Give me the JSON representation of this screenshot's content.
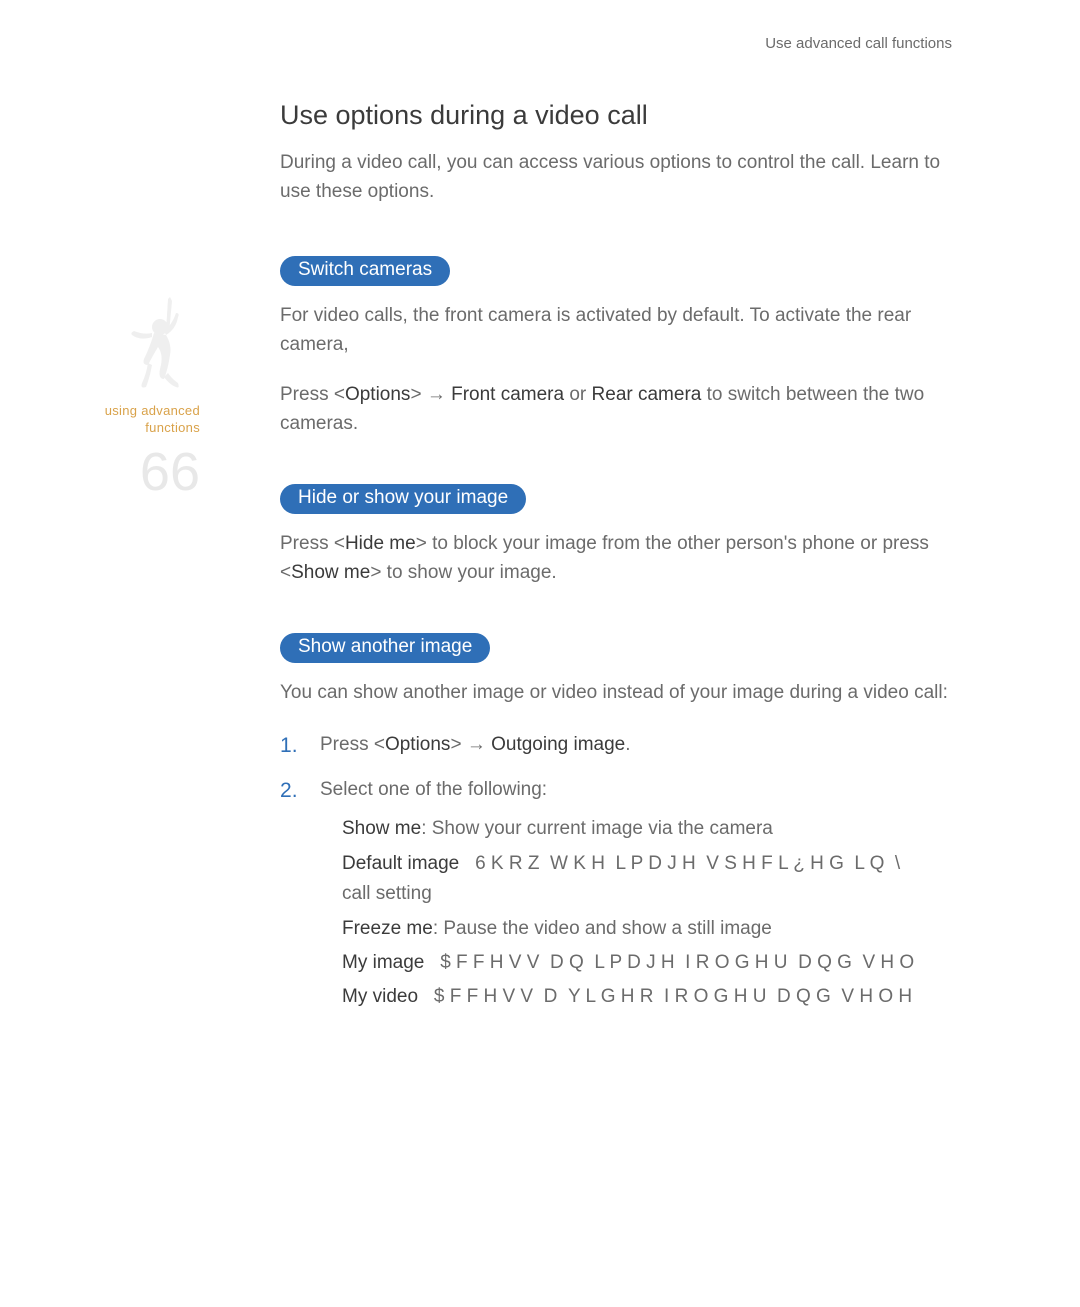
{
  "header": {
    "breadcrumb": "Use advanced call functions"
  },
  "sidebar": {
    "label_line1": "using advanced",
    "label_line2": "functions",
    "page_number": "66"
  },
  "title": "Use options during a video call",
  "intro": "During a video call, you can access various options to control the call. Learn to use these options.",
  "sections": {
    "switch_cameras": {
      "pill": "Switch cameras",
      "para1": "For video calls, the front camera is activated by default. To activate the rear camera,",
      "para2_pre": "Press <",
      "para2_options": "Options",
      "para2_mid1": "> ",
      "arrow": "→",
      "para2_mid2": " ",
      "para2_front": "Front camera",
      "para2_or": " or ",
      "para2_rear": "Rear camera",
      "para2_post": " to switch between the two cameras."
    },
    "hide_show": {
      "pill": "Hide or show your image",
      "text_pre": "Press <",
      "hide_me": "Hide me",
      "text_mid1": "> to block your image from the other person's phone or press <",
      "show_me": "Show me",
      "text_post": "> to show your image."
    },
    "show_another": {
      "pill": "Show another image",
      "intro": "You can show another image or video instead of your image during a video call:",
      "step1_pre": "Press <",
      "step1_opt": "Options",
      "step1_mid": "> ",
      "step1_arrow": "→",
      "step1_sp": " ",
      "step1_out": "Outgoing image",
      "step1_post": ".",
      "step2_intro": "Select one of the following:",
      "items": {
        "showme_k": "Show me",
        "showme_t": ": Show your current image via the camera",
        "default_k": "Default image",
        "default_t": "   6 K R Z  W K H  L P D J H  V S H F L ¿ H G  L Q  \\",
        "default_t2": "call setting",
        "freeze_k": "Freeze me",
        "freeze_t": ": Pause the video and show a still image",
        "myimage_k": "My image",
        "myimage_t": "   $ F F H V V  D Q  L P D J H  I R O G H U  D Q G  V H O",
        "myvideo_k": "My video",
        "myvideo_t": "   $ F F H V V  D  Y L G H R  I R O G H U  D Q G  V H O H"
      }
    }
  }
}
